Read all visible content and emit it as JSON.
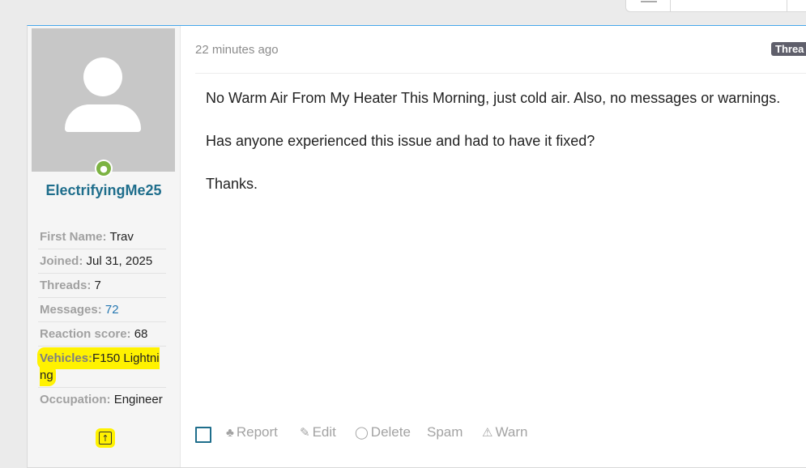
{
  "post": {
    "time": "22 minutes ago",
    "badge": "Threa",
    "paragraphs": [
      "No Warm Air From My Heater This Morning, just cold air. Also, no messages or warnings.",
      "Has anyone experienced this issue and had to have it fixed?",
      "Thanks."
    ]
  },
  "user": {
    "username": "ElectrifyingMe25",
    "stats": [
      {
        "label": "First Name:",
        "value": "Trav"
      },
      {
        "label": "Joined:",
        "value": "Jul 31, 2025"
      },
      {
        "label": "Threads:",
        "value": "7"
      },
      {
        "label": "Messages:",
        "value": "72"
      },
      {
        "label": "Reaction score:",
        "value": "68"
      },
      {
        "label": "Vehicles:",
        "value": "F150 Lightning"
      },
      {
        "label": "Occupation:",
        "value": "Engineer"
      }
    ]
  },
  "actions": {
    "report": "Report",
    "edit": "Edit",
    "delete": "Delete",
    "spam": "Spam",
    "warn": "Warn"
  },
  "colors": {
    "accent": "#1f6e8c",
    "highlight": "#fff200",
    "online": "#7cb342"
  }
}
